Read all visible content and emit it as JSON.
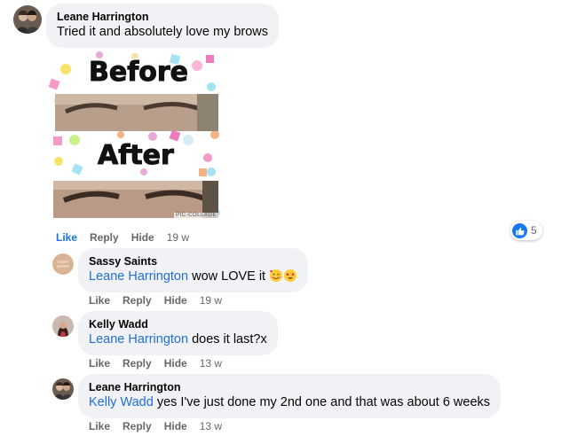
{
  "comment_main": {
    "author": "Leane Harrington",
    "text": "Tried it and absolutely love my brows",
    "image": {
      "before_label": "Before",
      "after_label": "After",
      "watermark": "PIC-COLLAGE"
    },
    "actions": {
      "like": "Like",
      "reply": "Reply",
      "hide": "Hide",
      "time": "19 w"
    },
    "reaction_count": "5",
    "reaction_icon": "thumbs-up-icon"
  },
  "replies": [
    {
      "author": "Sassy Saints",
      "mention": "Leane Harrington",
      "text": " wow LOVE it",
      "emojis": [
        "smiling-face-with-hearts",
        "heart-eyes"
      ],
      "actions": {
        "like": "Like",
        "reply": "Reply",
        "hide": "Hide",
        "time": "19 w"
      }
    },
    {
      "author": "Kelly Wadd",
      "mention": "Leane Harrington",
      "text": " does it last?x",
      "actions": {
        "like": "Like",
        "reply": "Reply",
        "hide": "Hide",
        "time": "13 w"
      }
    },
    {
      "author": "Leane Harrington",
      "mention": "Kelly Wadd",
      "text": " yes I've just done my 2nd one and that was about 6 weeks",
      "actions": {
        "like": "Like",
        "reply": "Reply",
        "hide": "Hide",
        "time": "13 w"
      }
    }
  ],
  "colors": {
    "accent": "#1b74e4",
    "mention": "#216fdb",
    "bubble": "#f0f2f5",
    "muted": "#65676b"
  }
}
